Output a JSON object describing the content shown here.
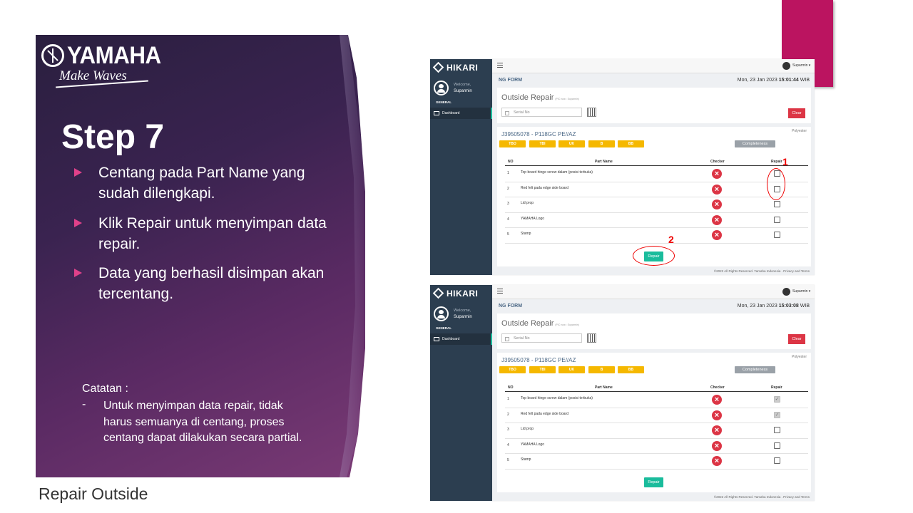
{
  "slide": {
    "logo_brand": "YAMAHA",
    "logo_tagline": "Make Waves",
    "step_title": "Step 7",
    "bullets": [
      "Centang pada Part Name yang sudah dilengkapi.",
      "Klik Repair untuk menyimpan data repair.",
      "Data yang berhasil disimpan akan tercentang."
    ],
    "note_title": "Catatan :",
    "note_dash": "-",
    "note_text": "Untuk menyimpan data repair, tidak harus semuanya di centang, proses centang dapat dilakukan secara partial.",
    "caption": "Repair Outside",
    "colors": {
      "panel": "#3a2350",
      "accent": "#bb1460",
      "bullet": "#e0418a"
    }
  },
  "app_common": {
    "brand": "HIKARI",
    "welcome": "Welcome,",
    "user": "Suparmin",
    "nav_section": "GENERAL",
    "nav_item": "Dashboard",
    "topbar_user": "Suparmin ▾",
    "form_title": "NG FORM",
    "page_heading": "Outside Repair",
    "page_sub": "(PIC now : Suparmin)",
    "serial_placeholder": "Serial No",
    "clear_label": "Clear",
    "order": "J39505078 - P118GC PE//AZ",
    "material": "Polyester",
    "tags": [
      "TBO",
      "TBI",
      "UK",
      "B",
      "BB"
    ],
    "completeness": "Completeness",
    "columns": {
      "no": "NO",
      "part": "Part Name",
      "checker": "Checker",
      "repair": "Repair"
    },
    "rows": [
      {
        "no": "1",
        "part": "Top board hinge screw dalam (posisi terbuka)"
      },
      {
        "no": "2",
        "part": "Red felt pada edge side board"
      },
      {
        "no": "3",
        "part": "Lid prop"
      },
      {
        "no": "4",
        "part": "YAMAHA Logo"
      },
      {
        "no": "5",
        "part": "Stamp"
      }
    ],
    "checker_symbol": "×",
    "repair_label": "Repair",
    "footer": "©2022 All Rights Reserved. Yamaha Indonesia . Privacy and Terms"
  },
  "screens": [
    {
      "date": "Mon, 23 Jan 2023",
      "time": "15:01:44",
      "tz": "WIB",
      "checked": [
        false,
        false,
        false,
        false,
        false
      ]
    },
    {
      "date": "Mon, 23 Jan 2023",
      "time": "15:03:08",
      "tz": "WIB",
      "checked": [
        true,
        true,
        false,
        false,
        false
      ]
    }
  ],
  "annotations": {
    "one": "1",
    "two": "2"
  }
}
